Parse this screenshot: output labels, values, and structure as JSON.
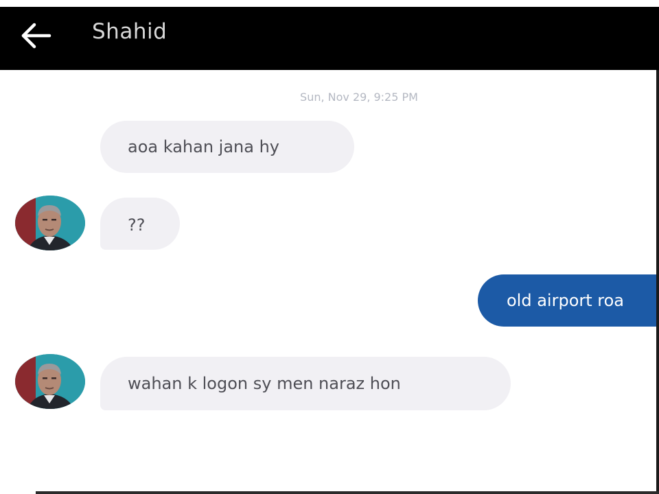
{
  "header": {
    "back_icon": "arrow-left-icon",
    "title": "Shahid"
  },
  "conversation": {
    "timestamp": "Sun, Nov 29, 9:25 PM",
    "messages": [
      {
        "direction": "incoming",
        "text": "aoa kahan jana hy",
        "avatar": false
      },
      {
        "direction": "incoming",
        "text": "??",
        "avatar": true
      },
      {
        "direction": "outgoing",
        "text": "old airport roa"
      },
      {
        "direction": "incoming",
        "text": "wahan k logon sy men naraz hon",
        "avatar": true
      }
    ]
  },
  "colors": {
    "header_bg": "#000000",
    "incoming_bubble": "#f1f0f4",
    "outgoing_bubble": "#1c5aa6",
    "timestamp": "#b4b8c2"
  }
}
